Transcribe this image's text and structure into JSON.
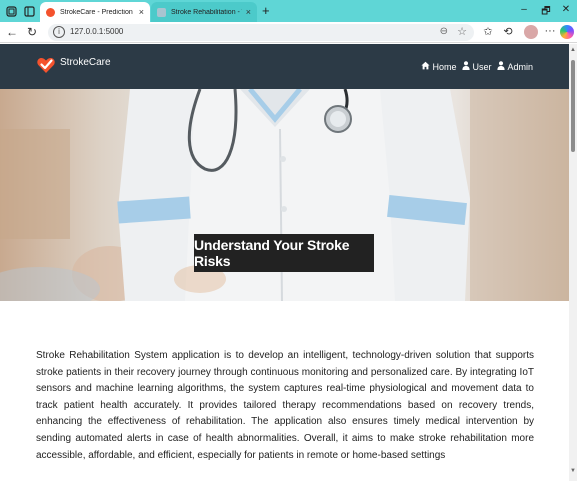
{
  "browser": {
    "tabs": [
      {
        "title": "StrokeCare - Prediction & Preventio",
        "active": true,
        "favicon_color": "#f4522d"
      },
      {
        "title": "Stroke Rehabilitation - ThingSpeak",
        "active": false,
        "favicon_color": "#a8c4d0"
      }
    ],
    "url": "127.0.0.1:5000",
    "tab_close_glyph": "×",
    "new_tab_glyph": "+",
    "window_controls": [
      "–",
      "🗗",
      "✕"
    ],
    "nav_icons": [
      "back-icon",
      "refresh-icon"
    ],
    "toolbar_icons": [
      "favorites-icon",
      "collections-icon",
      "history-icon",
      "profile-icon",
      "more-icon",
      "copilot-icon"
    ]
  },
  "navbar": {
    "brand": "StrokeCare",
    "brand_color": "#f4522d",
    "background": "#2c3a46",
    "links": [
      {
        "label": "Home",
        "icon": "home-icon"
      },
      {
        "label": "User",
        "icon": "user-icon"
      },
      {
        "label": "Admin",
        "icon": "user-icon"
      }
    ]
  },
  "hero": {
    "caption": "Understand Your Stroke Risks"
  },
  "about": {
    "text": "Stroke Rehabilitation System application is to develop an intelligent, technology-driven solution that supports stroke patients in their recovery journey through continuous monitoring and personalized care. By integrating IoT sensors and machine learning algorithms, the system captures real-time physiological and movement data to track patient health accurately. It provides tailored therapy recommendations based on recovery trends, enhancing the effectiveness of rehabilitation. The application also ensures timely medical intervention by sending automated alerts in case of health abnormalities. Overall, it aims to make stroke rehabilitation more accessible, affordable, and efficient, especially for patients in remote or home-based settings"
  }
}
